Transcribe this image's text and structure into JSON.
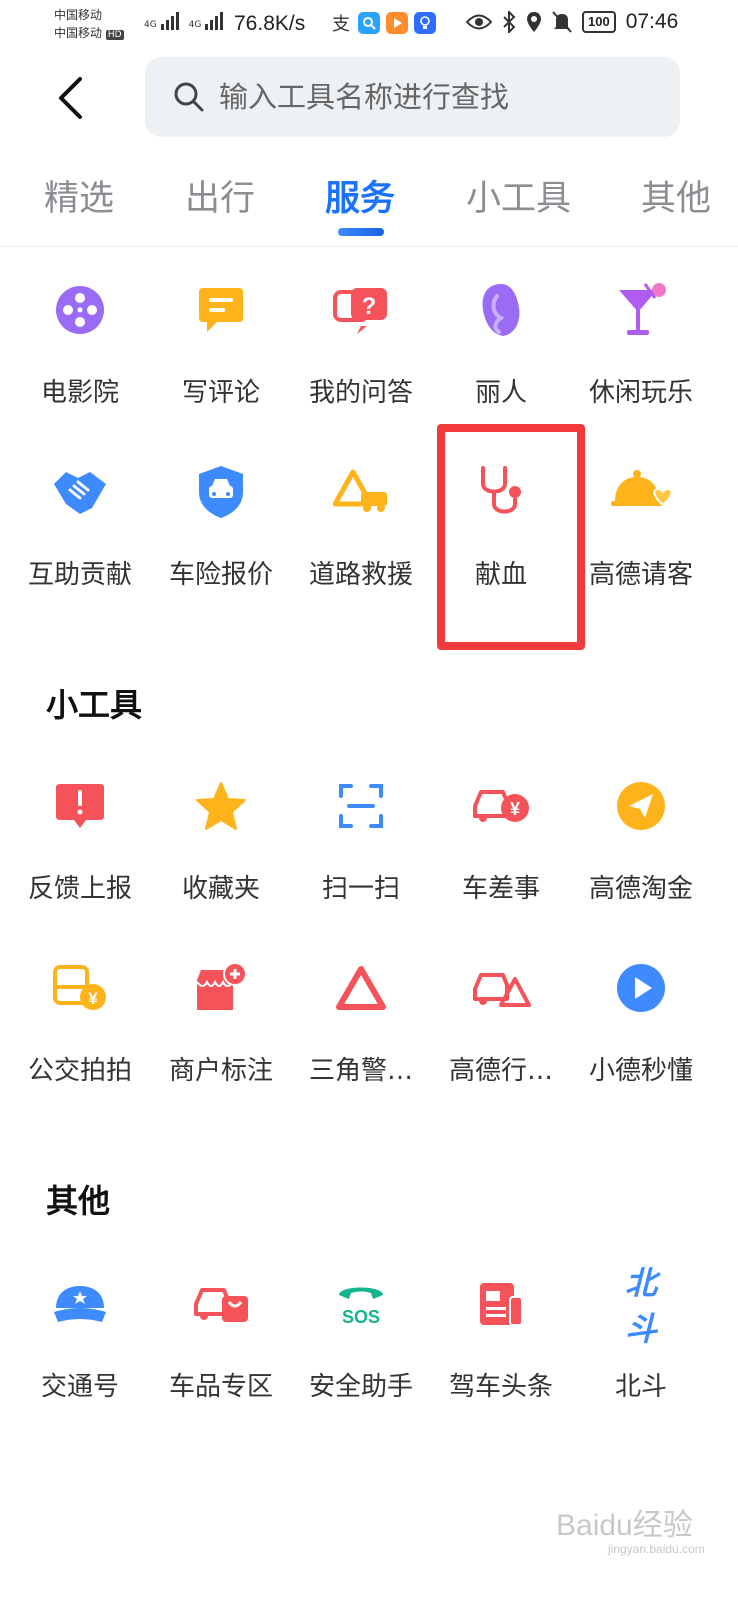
{
  "status_bar": {
    "carrier_1": "中国移动",
    "carrier_2": "中国移动",
    "hd_badge": "HD",
    "net_type": "4G",
    "speed": "76.8K/s",
    "battery": "100",
    "time": "07:46"
  },
  "header": {
    "search_placeholder": "输入工具名称进行查找"
  },
  "tabs": [
    {
      "label": "精选",
      "active": false
    },
    {
      "label": "出行",
      "active": false
    },
    {
      "label": "服务",
      "active": true
    },
    {
      "label": "小工具",
      "active": false
    },
    {
      "label": "其他",
      "active": false
    }
  ],
  "services": [
    {
      "label": "电影院",
      "icon": "film-reel-icon",
      "color": "#9a6cf5"
    },
    {
      "label": "写评论",
      "icon": "comment-icon",
      "color": "#ffb31a"
    },
    {
      "label": "我的问答",
      "icon": "qa-bubble-icon",
      "color": "#f5525a"
    },
    {
      "label": "丽人",
      "icon": "beauty-face-icon",
      "color": "#9a6cf5"
    },
    {
      "label": "休闲玩乐",
      "icon": "cocktail-icon",
      "color": "#b05cf0"
    },
    {
      "label": "互助贡献",
      "icon": "handshake-icon",
      "color": "#3d8bff"
    },
    {
      "label": "车险报价",
      "icon": "car-shield-icon",
      "color": "#3d8bff"
    },
    {
      "label": "道路救援",
      "icon": "road-rescue-icon",
      "color": "#ffb31a"
    },
    {
      "label": "献血",
      "icon": "stethoscope-icon",
      "color": "#f5525a"
    },
    {
      "label": "高德请客",
      "icon": "cloche-heart-icon",
      "color": "#ffb31a"
    }
  ],
  "tools_section": {
    "title": "小工具",
    "items": [
      {
        "label": "反馈上报",
        "icon": "feedback-alert-icon",
        "color": "#f5525a"
      },
      {
        "label": "收藏夹",
        "icon": "star-icon",
        "color": "#ffb31a"
      },
      {
        "label": "扫一扫",
        "icon": "scan-icon",
        "color": "#3d8bff"
      },
      {
        "label": "车差事",
        "icon": "car-yen-icon",
        "color": "#f5525a"
      },
      {
        "label": "高德淘金",
        "icon": "paper-plane-icon",
        "color": "#ffb31a"
      },
      {
        "label": "公交拍拍",
        "icon": "bus-yen-icon",
        "color": "#ffb31a"
      },
      {
        "label": "商户标注",
        "icon": "shop-add-icon",
        "color": "#f5525a"
      },
      {
        "label": "三角警…",
        "icon": "warning-triangle-icon",
        "color": "#f5525a"
      },
      {
        "label": "高德行…",
        "icon": "car-triangle-icon",
        "color": "#f5525a"
      },
      {
        "label": "小德秒懂",
        "icon": "play-icon",
        "color": "#3d8bff"
      }
    ]
  },
  "other_section": {
    "title": "其他",
    "items": [
      {
        "label": "交通号",
        "icon": "police-cap-icon",
        "color": "#3d8bff"
      },
      {
        "label": "车品专区",
        "icon": "car-bag-icon",
        "color": "#f5525a"
      },
      {
        "label": "安全助手",
        "icon": "sos-phone-icon",
        "color": "#14b48c"
      },
      {
        "label": "驾车头条",
        "icon": "news-icon",
        "color": "#f5525a"
      },
      {
        "label": "北斗",
        "icon": "beidou-logo",
        "color": "#3d8bff",
        "logo_text": "北斗"
      }
    ]
  },
  "watermark": {
    "text": "Baidu经验",
    "sub": "jingyan.baidu.com"
  }
}
